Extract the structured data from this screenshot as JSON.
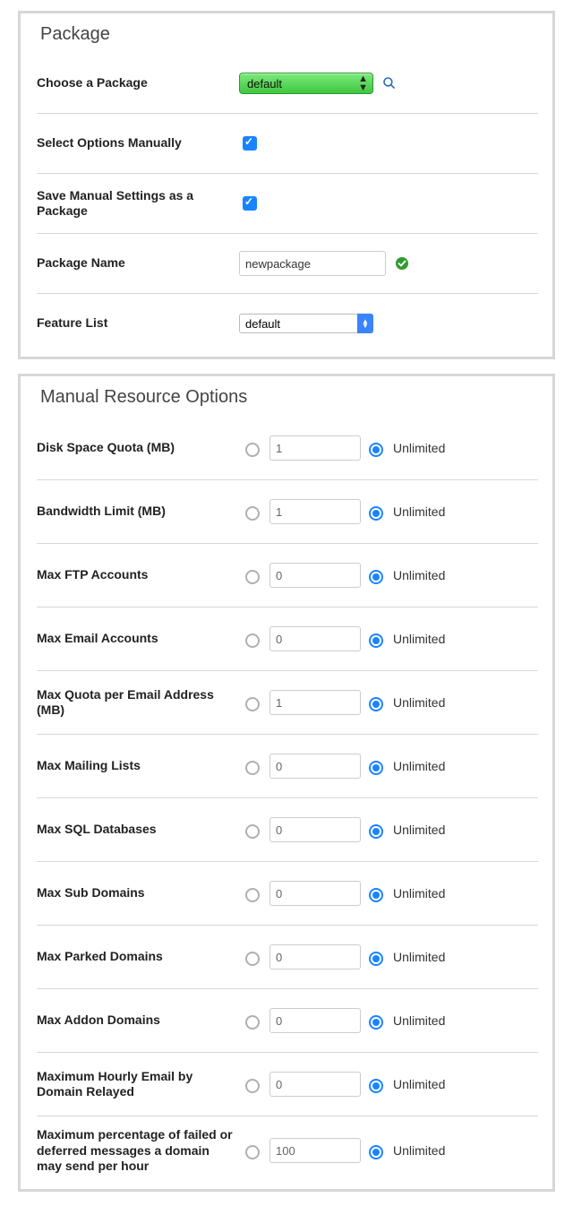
{
  "package": {
    "title": "Package",
    "choose_label": "Choose a Package",
    "choose_selected": "default",
    "select_manual_label": "Select Options Manually",
    "select_manual_checked": true,
    "save_manual_label": "Save Manual Settings as a Package",
    "save_manual_checked": true,
    "package_name_label": "Package Name",
    "package_name_value": "newpackage",
    "feature_list_label": "Feature List",
    "feature_list_selected": "default"
  },
  "resources": {
    "title": "Manual Resource Options",
    "unlimited_label": "Unlimited",
    "items": [
      {
        "label": "Disk Space Quota (MB)",
        "value": "1",
        "selected": "unlimited"
      },
      {
        "label": "Bandwidth Limit (MB)",
        "value": "1",
        "selected": "unlimited"
      },
      {
        "label": "Max FTP Accounts",
        "value": "0",
        "selected": "unlimited"
      },
      {
        "label": "Max Email Accounts",
        "value": "0",
        "selected": "unlimited"
      },
      {
        "label": "Max Quota per Email Address (MB)",
        "value": "1",
        "selected": "unlimited"
      },
      {
        "label": "Max Mailing Lists",
        "value": "0",
        "selected": "unlimited"
      },
      {
        "label": "Max SQL Databases",
        "value": "0",
        "selected": "unlimited"
      },
      {
        "label": "Max Sub Domains",
        "value": "0",
        "selected": "unlimited"
      },
      {
        "label": "Max Parked Domains",
        "value": "0",
        "selected": "unlimited"
      },
      {
        "label": "Max Addon Domains",
        "value": "0",
        "selected": "unlimited"
      },
      {
        "label": "Maximum Hourly Email by Domain Relayed",
        "value": "0",
        "selected": "unlimited"
      },
      {
        "label": "Maximum percentage of failed or deferred messages a domain may send per hour",
        "value": "100",
        "selected": "unlimited"
      }
    ]
  }
}
